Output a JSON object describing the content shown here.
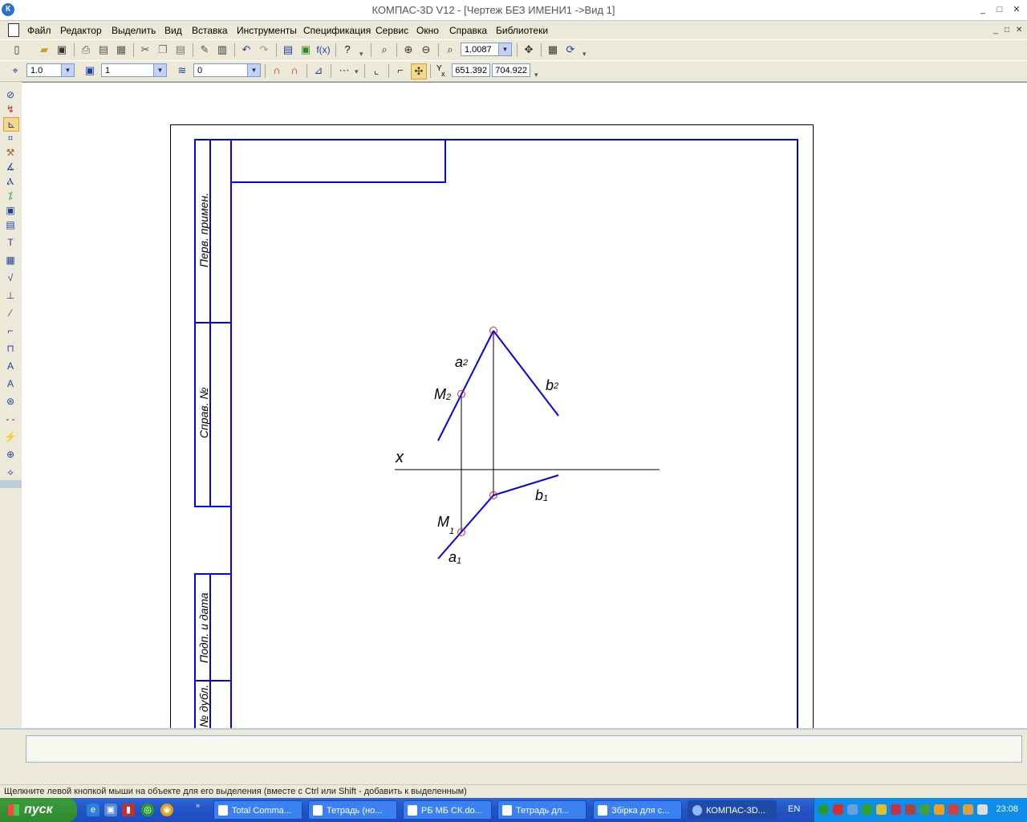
{
  "window": {
    "title": "КОМПАС-3D V12 - [Чертеж БЕЗ ИМЕНИ1 ->Вид 1]",
    "logo": "К",
    "controls": [
      "_",
      "□",
      "✕"
    ],
    "mdi_controls": [
      "_",
      "□",
      "✕"
    ]
  },
  "menu": [
    "Файл",
    "Редактор",
    "Выделить",
    "Вид",
    "Вставка",
    "Инструменты",
    "Спецификация",
    "Сервис",
    "Окно",
    "Справка",
    "Библиотеки"
  ],
  "toolbar1": {
    "zoom_value": "1.0087"
  },
  "toolbar2": {
    "step_value": "1.0",
    "style_value": "1",
    "layer_value": "0",
    "coord_x_label": "Y",
    "coord_x_sub": "x",
    "coord_x": "651.392",
    "coord_y": "704.922"
  },
  "stamp": {
    "col1": "Перв. примен.",
    "col2": "Справ. №",
    "col3": "Подп. и дата",
    "col4": "№ дубл."
  },
  "drawing": {
    "labels": {
      "x_axis": "x",
      "a2_main": "a",
      "a2_sub": "2",
      "b2_main": "b",
      "b2_sub": "2",
      "m2_main": "M",
      "m2_sub": "2",
      "b1_main": "b",
      "b1_sub": "1",
      "m1_main": "M",
      "m1_sub": "1",
      "a1_main": "a",
      "a1_sub": "1"
    },
    "line_color": "#0000ff",
    "point_color": "#e02020"
  },
  "status": {
    "hint": "Щелкните левой кнопкой мыши на объекте для его выделения (вместе с Ctrl или Shift - добавить к выделенным)"
  },
  "taskbar": {
    "start_label": "пуск",
    "tasks": [
      "Total Comma...",
      "Тетрадь (но...",
      "РБ МБ СК.do...",
      "Тетрадь дл...",
      "Збірка для с...",
      "КОМПАС-3D..."
    ],
    "language": "EN",
    "clock": "23:08"
  }
}
